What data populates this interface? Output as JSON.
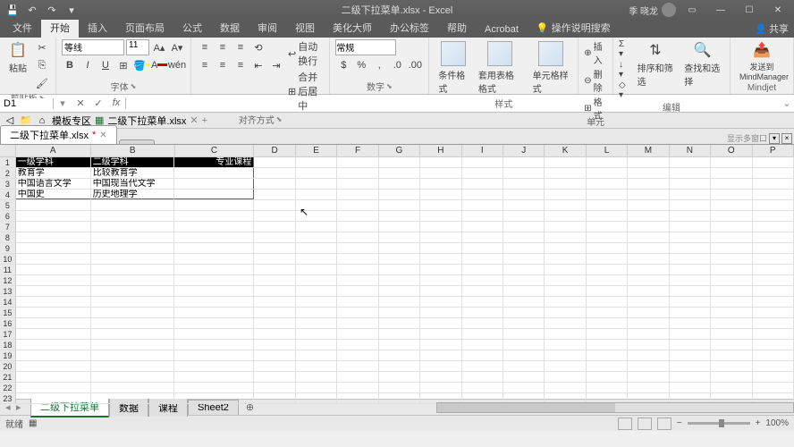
{
  "title": "二级下拉菜单.xlsx - Excel",
  "user": "季 晓龙",
  "share": "共享",
  "tabs": [
    "文件",
    "开始",
    "插入",
    "页面布局",
    "公式",
    "数据",
    "审阅",
    "视图",
    "美化大师",
    "办公标签",
    "帮助",
    "Acrobat"
  ],
  "tell_me": "操作说明搜索",
  "ribbon": {
    "clipboard": {
      "label": "剪贴板",
      "paste": "粘贴"
    },
    "font": {
      "label": "字体",
      "name": "等线",
      "size": "11"
    },
    "align": {
      "label": "对齐方式",
      "wrap": "自动换行",
      "merge": "合并后居中"
    },
    "number": {
      "label": "数字",
      "format": "常规"
    },
    "styles": {
      "label": "样式",
      "cond": "条件格式",
      "table": "套用表格格式",
      "cell": "单元格样式"
    },
    "cells": {
      "label": "单元格",
      "insert": "插入",
      "delete": "删除",
      "format": "格式"
    },
    "editing": {
      "label": "编辑",
      "sort": "排序和筛选",
      "find": "查找和选择"
    },
    "mindjet": {
      "label": "Mindjet",
      "send": "发送到MindManager"
    }
  },
  "namebox": "D1",
  "formula": "",
  "navbar": {
    "templates": "模板专区",
    "file": "二级下拉菜单.xlsx"
  },
  "wbtab": "二级下拉菜单.xlsx",
  "wb_more": "显示多窗口",
  "cols": [
    "A",
    "B",
    "C",
    "D",
    "E",
    "F",
    "G",
    "H",
    "I",
    "J",
    "K",
    "L",
    "M",
    "N",
    "O",
    "P"
  ],
  "headers": {
    "a": "一级学科",
    "b": "二级学科",
    "c": "专业课程"
  },
  "data": [
    {
      "a": "教育学",
      "b": "比较教育学",
      "c": ""
    },
    {
      "a": "中国语言文学",
      "b": "中国现当代文学",
      "c": ""
    },
    {
      "a": "中国史",
      "b": "历史地理学",
      "c": ""
    }
  ],
  "sheets": [
    "二级下拉菜单",
    "数据",
    "课程",
    "Sheet2"
  ],
  "status": {
    "ready": "就绪",
    "zoom": "100%"
  }
}
